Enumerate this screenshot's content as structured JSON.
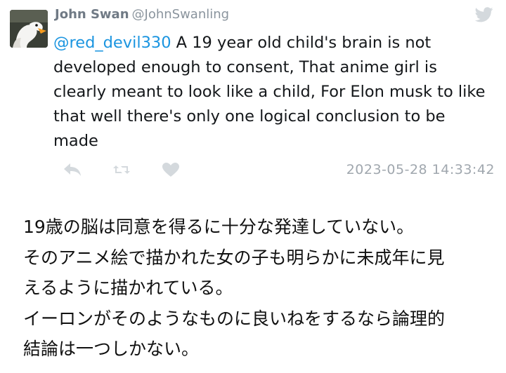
{
  "tweet": {
    "display_name": "John Swan",
    "handle": "@JohnSwanling",
    "mention": "@red_devil330",
    "body": " A 19 year old child's brain is not developed enough to consent, That anime girl is clearly meant to look like a child, For Elon musk to like that well there's only one logical conclusion to be made",
    "timestamp": "2023-05-28 14:33:42",
    "icons": {
      "brand": "twitter-bird-icon",
      "reply": "reply-icon",
      "retweet": "retweet-icon",
      "like": "heart-icon"
    }
  },
  "translation": {
    "lines": [
      "19歳の脳は同意を得るに十分な発達していない。",
      "そのアニメ絵で描かれた女の子も明らかに未成年に見",
      "えるように描かれている。",
      "イーロンがそのようなものに良いねをするなら論理的",
      "結論は一つしかない。"
    ]
  },
  "colors": {
    "mention": "#1b95e0",
    "name": "#707a85",
    "meta": "#a0a7ae",
    "icons": "#d4d9dd"
  }
}
